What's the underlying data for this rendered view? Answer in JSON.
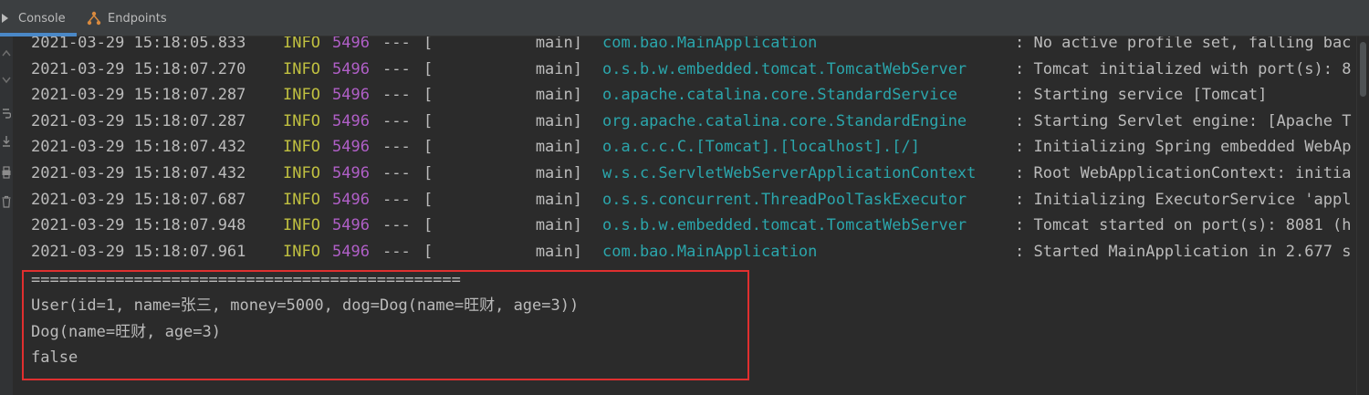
{
  "tabs": [
    {
      "label": "Console",
      "icon": "console-icon",
      "active": true
    },
    {
      "label": "Endpoints",
      "icon": "endpoints-icon",
      "active": false
    }
  ],
  "log_lines": [
    {
      "timestamp": "2021-03-29 15:18:05.833",
      "level": "INFO",
      "pid": "5496",
      "sep": "---",
      "thread": "[           main]",
      "logger": "com.bao.MainApplication",
      "message": ": No active profile set, falling bac"
    },
    {
      "timestamp": "2021-03-29 15:18:07.270",
      "level": "INFO",
      "pid": "5496",
      "sep": "---",
      "thread": "[           main]",
      "logger": "o.s.b.w.embedded.tomcat.TomcatWebServer",
      "message": ": Tomcat initialized with port(s): 8"
    },
    {
      "timestamp": "2021-03-29 15:18:07.287",
      "level": "INFO",
      "pid": "5496",
      "sep": "---",
      "thread": "[           main]",
      "logger": "o.apache.catalina.core.StandardService",
      "message": ": Starting service [Tomcat]"
    },
    {
      "timestamp": "2021-03-29 15:18:07.287",
      "level": "INFO",
      "pid": "5496",
      "sep": "---",
      "thread": "[           main]",
      "logger": "org.apache.catalina.core.StandardEngine",
      "message": ": Starting Servlet engine: [Apache T"
    },
    {
      "timestamp": "2021-03-29 15:18:07.432",
      "level": "INFO",
      "pid": "5496",
      "sep": "---",
      "thread": "[           main]",
      "logger": "o.a.c.c.C.[Tomcat].[localhost].[/]",
      "message": ": Initializing Spring embedded WebAp"
    },
    {
      "timestamp": "2021-03-29 15:18:07.432",
      "level": "INFO",
      "pid": "5496",
      "sep": "---",
      "thread": "[           main]",
      "logger": "w.s.c.ServletWebServerApplicationContext",
      "message": ": Root WebApplicationContext: initia"
    },
    {
      "timestamp": "2021-03-29 15:18:07.687",
      "level": "INFO",
      "pid": "5496",
      "sep": "---",
      "thread": "[           main]",
      "logger": "o.s.s.concurrent.ThreadPoolTaskExecutor",
      "message": ": Initializing ExecutorService 'appl"
    },
    {
      "timestamp": "2021-03-29 15:18:07.948",
      "level": "INFO",
      "pid": "5496",
      "sep": "---",
      "thread": "[           main]",
      "logger": "o.s.b.w.embedded.tomcat.TomcatWebServer",
      "message": ": Tomcat started on port(s): 8081 (h"
    },
    {
      "timestamp": "2021-03-29 15:18:07.961",
      "level": "INFO",
      "pid": "5496",
      "sep": "---",
      "thread": "[           main]",
      "logger": "com.bao.MainApplication",
      "message": ": Started MainApplication in 2.677 s"
    }
  ],
  "output_lines": [
    "==============================================",
    "User(id=1, name=张三, money=5000, dog=Dog(name=旺财, age=3))",
    "Dog(name=旺财, age=3)",
    "false"
  ],
  "colors": {
    "background": "#2b2b2b",
    "level_info": "#c0c040",
    "pid": "#b05fc7",
    "logger": "#2ba6ac",
    "highlight_border": "#e02f2f",
    "tab_active_underline": "#4a88c7"
  }
}
